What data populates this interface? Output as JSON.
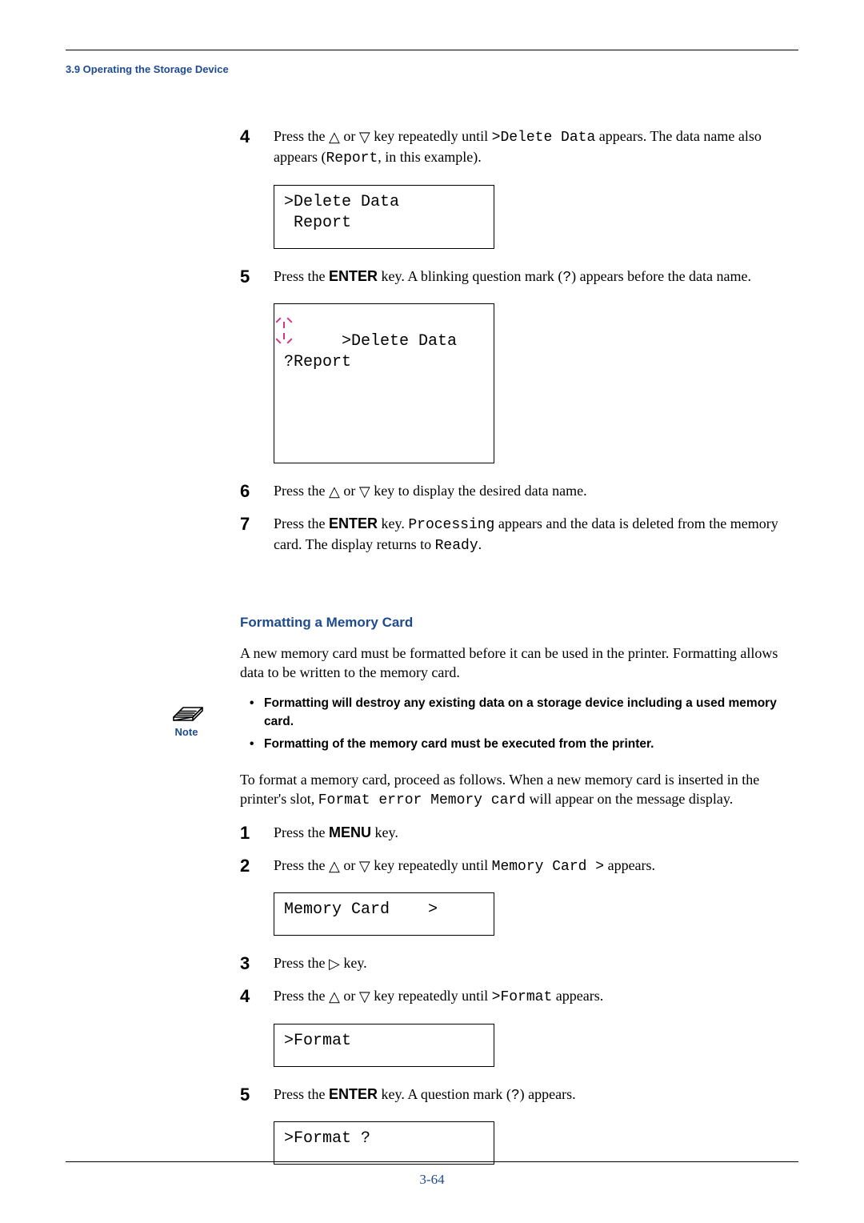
{
  "header": {
    "running_head": "3.9 Operating the Storage Device"
  },
  "sectionA": {
    "steps": {
      "n4": "4",
      "t4a": "Press the ",
      "t4b": " or ",
      "t4c": " key repeatedly until ",
      "t4d": ">Delete Data",
      "t4e": " appears. The data name also appears (",
      "t4f": "Report",
      "t4g": ", in this example).",
      "lcd4": ">Delete Data\n Report",
      "n5": "5",
      "t5a": "Press the ",
      "t5b": "ENTER",
      "t5c": " key. A blinking question mark (",
      "t5d": "?",
      "t5e": ") appears before the data name.",
      "lcd5_line1": ">Delete Data",
      "lcd5_line2": "?Report",
      "n6": "6",
      "t6a": "Press the ",
      "t6b": " or ",
      "t6c": " key to display the desired data name.",
      "n7": "7",
      "t7a": "Press the ",
      "t7b": "ENTER",
      "t7c": " key. ",
      "t7d": "Processing",
      "t7e": " appears and the data is deleted from the memory card. The display returns to ",
      "t7f": "Ready",
      "t7g": "."
    }
  },
  "sectionB": {
    "heading": "Formatting a Memory Card",
    "intro": "A new memory card must be formatted before it can be used in the printer. Formatting allows data to be written to the memory card.",
    "note_label": "Note",
    "notes": {
      "n1": "Formatting will destroy any existing data on a storage device including a used memory card.",
      "n2": "Formatting of the memory card must be executed from the printer."
    },
    "lead_a": "To format a memory card, proceed as follows. When a new memory card is inserted in the printer's slot, ",
    "lead_b": "Format error Memory card",
    "lead_c": " will appear on the message display.",
    "steps": {
      "n1": "1",
      "t1a": "Press the ",
      "t1b": "MENU",
      "t1c": " key.",
      "n2": "2",
      "t2a": "Press the ",
      "t2b": " or ",
      "t2c": " key repeatedly until ",
      "t2d": "Memory Card >",
      "t2e": " appears.",
      "lcd2": "Memory Card    >",
      "n3": "3",
      "t3a": "Press the ",
      "t3b": " key.",
      "n4": "4",
      "t4a": "Press the ",
      "t4b": " or ",
      "t4c": " key repeatedly until ",
      "t4d": ">Format",
      "t4e": " appears.",
      "lcd4": ">Format",
      "n5": "5",
      "t5a": "Press the ",
      "t5b": "ENTER",
      "t5c": " key. A question mark (",
      "t5d": "?",
      "t5e": ") appears.",
      "lcd5": ">Format ?"
    }
  },
  "footer": {
    "page": "3-64"
  },
  "glyphs": {
    "tri_up": "△",
    "tri_down": "▽",
    "tri_right": "▷"
  }
}
